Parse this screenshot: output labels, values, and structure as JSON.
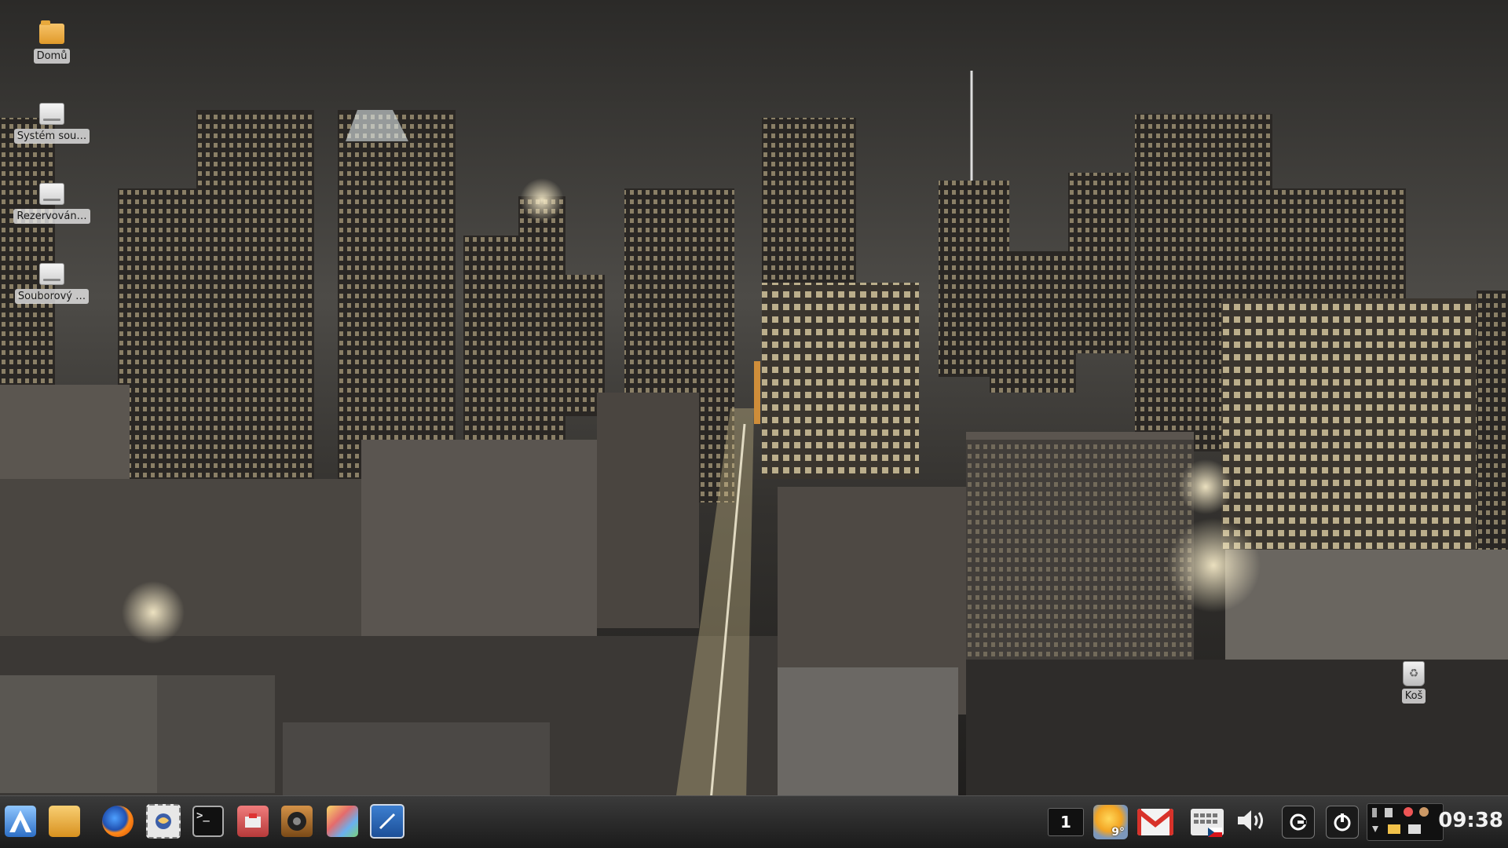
{
  "desktop": {
    "icons": [
      {
        "label": "Domů",
        "icon": "home-folder-icon"
      },
      {
        "label": "Systém sou…",
        "icon": "drive-icon"
      },
      {
        "label": "Rezervován…",
        "icon": "drive-icon"
      },
      {
        "label": "Souborový …",
        "icon": "drive-icon"
      },
      {
        "label": "Koš",
        "icon": "trash-icon"
      }
    ]
  },
  "taskbar": {
    "launchers": [
      {
        "name": "application-menu",
        "icon": "app-menu-icon"
      },
      {
        "name": "file-manager",
        "icon": "folder-icon"
      },
      {
        "name": "firefox",
        "icon": "firefox-icon"
      },
      {
        "name": "mail-client",
        "icon": "thunderbird-icon"
      },
      {
        "name": "terminal",
        "icon": "terminal-icon"
      },
      {
        "name": "software-center",
        "icon": "software-icon"
      },
      {
        "name": "audio-player",
        "icon": "speaker-icon"
      },
      {
        "name": "image-editor",
        "icon": "paint-icon"
      },
      {
        "name": "screenshot-tool",
        "icon": "screenshot-icon"
      }
    ],
    "tray": {
      "workspace": "1",
      "weather_temp": "9°",
      "icons": [
        "gmail-icon",
        "keyboard-layout-icon",
        "volume-icon",
        "update-icon",
        "shutdown-icon",
        "tray-area-icon"
      ],
      "clock": "09:38"
    }
  }
}
